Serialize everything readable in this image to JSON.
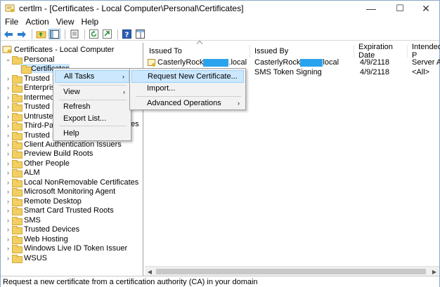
{
  "window": {
    "app_name": "certlm",
    "title": "certlm - [Certificates - Local Computer\\Personal\\Certificates]",
    "minimize": "—",
    "maximize": "☐",
    "close": "✕"
  },
  "menu": [
    "File",
    "Action",
    "View",
    "Help"
  ],
  "toolbar_icons": [
    "back-icon",
    "forward-icon",
    "up-folder-icon",
    "show-hide-tree-icon",
    "properties-icon",
    "refresh-icon",
    "export-list-icon",
    "help-icon",
    "snapin-pane-icon"
  ],
  "tree": {
    "root": "Certificates - Local Computer",
    "personal": "Personal",
    "certificates": "Certificates",
    "partial_items": [
      "Trusted Ro",
      "Enterprise",
      "Intermedi",
      "Trusted Pu",
      "Untrusted",
      "Third-Part",
      "Trusted Pe"
    ],
    "items": [
      "Client Authentication Issuers",
      "Preview Build Roots",
      "Other People",
      "ALM",
      "Local NonRemovable Certificates",
      "Microsoft Monitoring Agent",
      "Remote Desktop",
      "Smart Card Trusted Roots",
      "SMS",
      "Trusted Devices",
      "Web Hosting",
      "Windows Live ID Token Issuer",
      "WSUS"
    ],
    "overflow_text": "es"
  },
  "columns": [
    "Issued To",
    "Issued By",
    "Expiration Date",
    "Intended P"
  ],
  "rows": [
    {
      "issued_to_a": "CasterlyRock",
      "issued_to_b": ".local",
      "issued_by_a": "CasterlyRock",
      "issued_by_b": "local",
      "expiration": "4/9/2118",
      "intended": "Server Aut"
    },
    {
      "issued_to_a": "",
      "issued_to_b": "",
      "issued_by_a": "SMS Token Signing",
      "issued_by_b": "",
      "expiration": "4/9/2118",
      "intended": "<All>"
    }
  ],
  "context_menu": {
    "items": [
      "All Tasks",
      "View",
      "Refresh",
      "Export List...",
      "Help"
    ]
  },
  "submenu": {
    "items": [
      "Request New Certificate...",
      "Import...",
      "Advanced Operations"
    ]
  },
  "status": "Request a new certificate from a certification authority (CA) in your domain",
  "colors": {
    "accent_selection": "#cce8ff",
    "redaction": "#2aa3ee",
    "folder": "#f2cf63"
  }
}
